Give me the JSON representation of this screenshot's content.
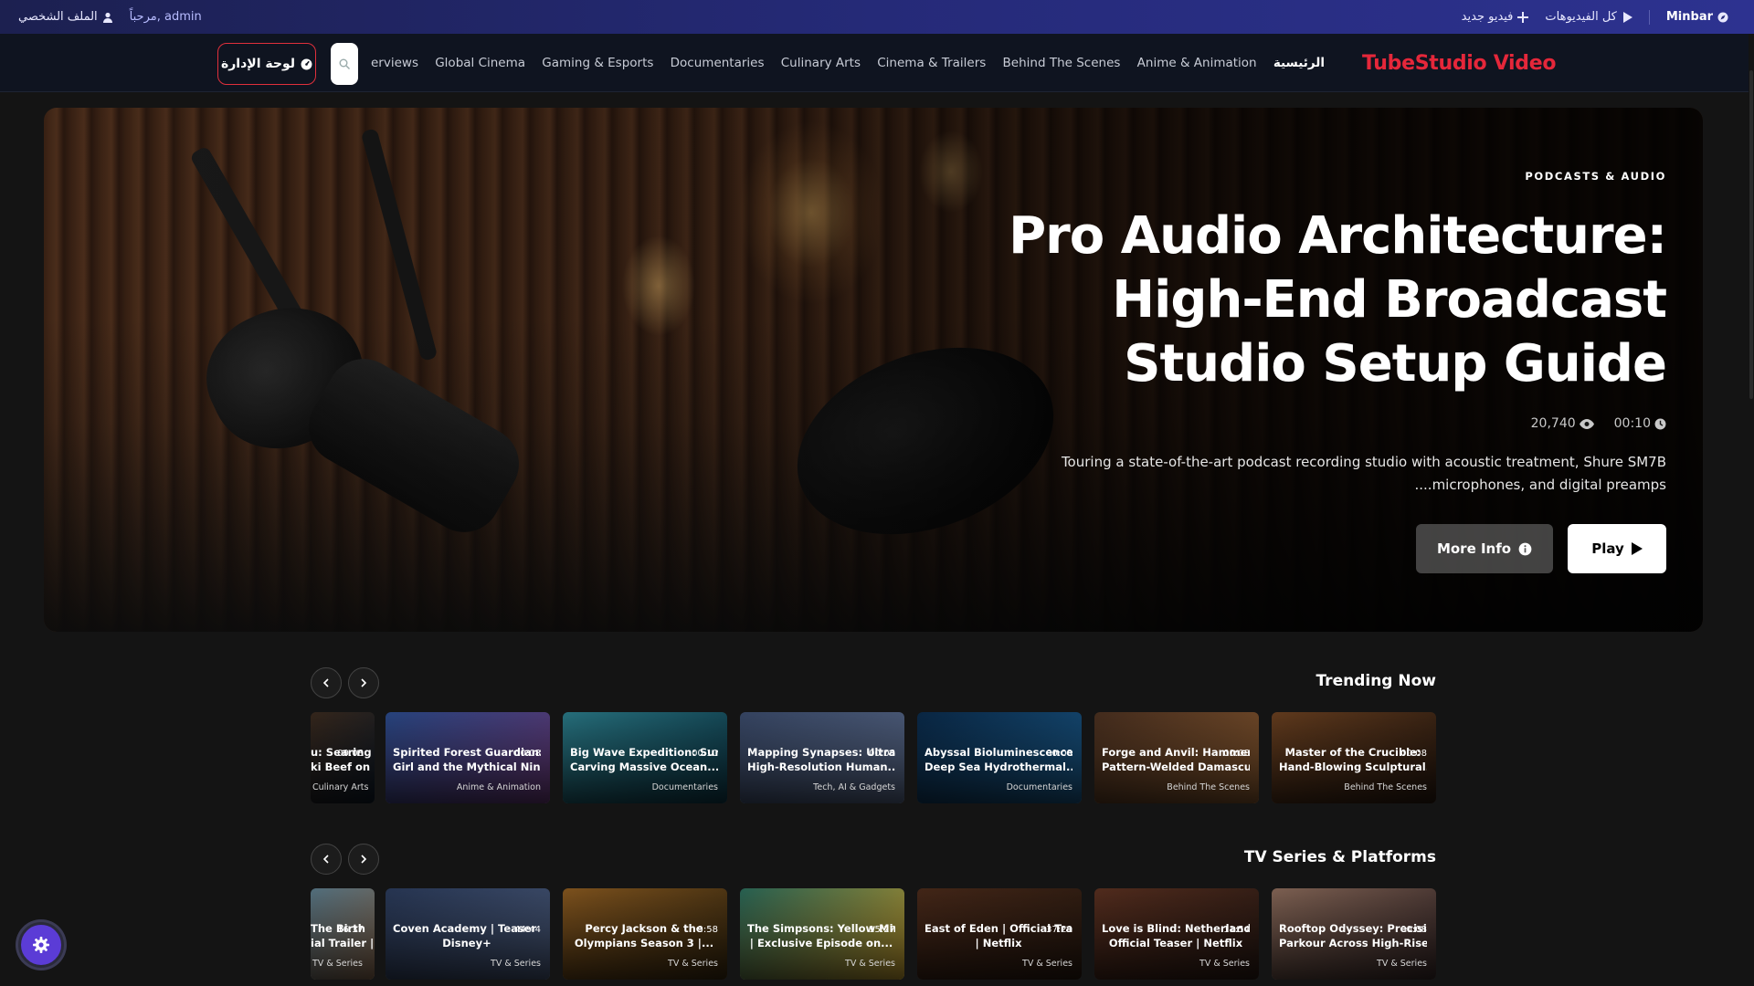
{
  "topbar": {
    "brand": "Minbar",
    "all_videos": "كل الفيديوهات",
    "new_video": "فيديو جديد",
    "welcome": "مرحباً, admin",
    "profile": "الملف الشخصي"
  },
  "nav": {
    "brand": "TubeStudio Video",
    "admin_label": "لوحة الإدارة",
    "links": [
      "erviews",
      "Global Cinema",
      "Gaming & Esports",
      "Documentaries",
      "Culinary Arts",
      "Cinema & Trailers",
      "Behind The Scenes",
      "Anime & Animation",
      "الرئيسية"
    ]
  },
  "hero": {
    "category": "PODCASTS & AUDIO",
    "title_lines": [
      "Pro Audio Architecture:",
      "High-End Broadcast",
      "Studio Setup Guide"
    ],
    "views": "20,740",
    "duration": "00:10",
    "description_lines": [
      "Touring a state-of-the-art podcast recording studio with acoustic treatment, Shure SM7B",
      "microphones, and digital preamps...."
    ],
    "more_info": "More Info",
    "play": "Play"
  },
  "rows": [
    {
      "title": "Trending Now",
      "cards": [
        {
          "l1": "u: Searing",
          "l2": "ki Beef on",
          "dur": "00:08",
          "cat": "Culinary Arts",
          "c1": "#3a2a1e",
          "c2": "#0e1a28"
        },
        {
          "l1": "Spirited Forest Guardian:",
          "l2": "Girl and the Mythical Nine-...",
          "dur": "00:08",
          "cat": "Anime & Animation",
          "c1": "#2a4a8a",
          "c2": "#6a3a7a"
        },
        {
          "l1": "Big Wave Expedition: Surfer",
          "l2": "Carving Massive Ocean...",
          "dur": "00:10",
          "cat": "Documentaries",
          "c1": "#2a7a88",
          "c2": "#0e3a4a"
        },
        {
          "l1": "Mapping Synapses: Ultra-",
          "l2": "High-Resolution Human...",
          "dur": "00:08",
          "cat": "Tech, AI & Gadgets",
          "c1": "#3a4a6a",
          "c2": "#5a6a8a"
        },
        {
          "l1": "Abyssal Bioluminescence:",
          "l2": "Deep Sea Hydrothermal...",
          "dur": "00:08",
          "cat": "Documentaries",
          "c1": "#0a2a4a",
          "c2": "#1a5a8a"
        },
        {
          "l1": "Forge and Anvil: Hammering",
          "l2": "Pattern-Welded Damascus...",
          "dur": "00:08",
          "cat": "Behind The Scenes",
          "c1": "#4a3020",
          "c2": "#8a5a30"
        },
        {
          "l1": "Master of the Crucible:",
          "l2": "Hand-Blowing Sculptural...",
          "dur": "00:08",
          "cat": "Behind The Scenes",
          "c1": "#6a4020",
          "c2": "#2a1a10"
        }
      ]
    },
    {
      "title": "TV Series & Platforms",
      "cards": [
        {
          "l1": "The Birth",
          "l2": "ial Trailer |",
          "dur": "16:37",
          "cat": "TV & Series",
          "c1": "#5a7a8a",
          "c2": "#8a6a50"
        },
        {
          "l1": "Coven Academy | Teaser |",
          "l2": "Disney+",
          "dur": "44:44",
          "cat": "TV & Series",
          "c1": "#2a3a5a",
          "c2": "#4a5a7a"
        },
        {
          "l1": "Percy Jackson & the",
          "l2": "Olympians Season 3 |...",
          "dur": "9:58",
          "cat": "TV & Series",
          "c1": "#8a5a20",
          "c2": "#3a2a10"
        },
        {
          "l1": "The Simpsons: Yellow Mirror",
          "l2": "| Exclusive Episode on...",
          "dur": "15:27",
          "cat": "TV & Series",
          "c1": "#2a6a5a",
          "c2": "#c8a030"
        },
        {
          "l1": "East of Eden | Official Trailer",
          "l2": "| Netflix",
          "dur": "37:29",
          "cat": "TV & Series",
          "c1": "#4a2a1a",
          "c2": "#2a1a10"
        },
        {
          "l1": "Love is Blind: Netherlands |",
          "l2": "Official Teaser | Netflix",
          "dur": "11:54",
          "cat": "TV & Series",
          "c1": "#5a3020",
          "c2": "#2a1a14"
        },
        {
          "l1": "Rooftop Odyssey: Precision",
          "l2": "Parkour Across High-Rise...",
          "dur": "00:08",
          "cat": "TV & Series",
          "c1": "#8a6a5a",
          "c2": "#3a2a2a"
        }
      ]
    }
  ]
}
